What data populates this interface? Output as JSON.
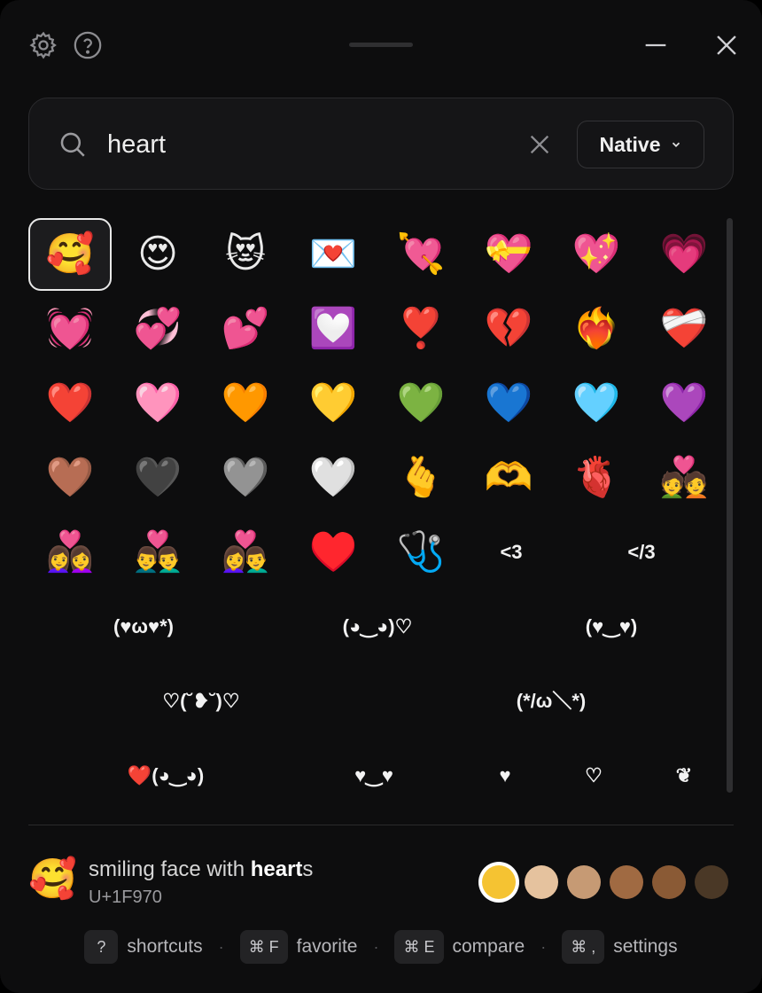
{
  "titlebar": {
    "icons": [
      "gear-icon",
      "help-icon",
      "minimize-icon",
      "close-icon"
    ]
  },
  "search": {
    "value": "heart",
    "mode_label": "Native"
  },
  "grid": {
    "emoji_rows": [
      [
        "🥰",
        "😍",
        "😻",
        "💌",
        "💘",
        "💝",
        "💖",
        "💗"
      ],
      [
        "💓",
        "💞",
        "💕",
        "💟",
        "❣️",
        "💔",
        "❤️‍🔥",
        "❤️‍🩹"
      ],
      [
        "❤️",
        "🩷",
        "🧡",
        "💛",
        "💚",
        "💙",
        "🩵",
        "💜"
      ],
      [
        "🤎",
        "🖤",
        "🩶",
        "🤍",
        "🫰",
        "🫶",
        "🫀",
        "💑"
      ],
      [
        "👩‍❤️‍👩",
        "👨‍❤️‍👨",
        "👩‍❤️‍👨",
        "♥️",
        "🩺"
      ]
    ],
    "row5_text": [
      "<3",
      "</3"
    ],
    "row6": [
      "(♥ω♥*)",
      "(◕‿◕)♡",
      "(♥‿♥)"
    ],
    "row7": [
      "♡(˘❥˘)♡",
      "(*/ω＼*)"
    ],
    "row8": [
      "❤️(◕‿◕)",
      "♥‿♥",
      "♥",
      "♡",
      "❦"
    ]
  },
  "preview": {
    "emoji": "🥰",
    "name_prefix": "smiling face with ",
    "name_match": "heart",
    "name_suffix": "s",
    "code": "U+1F970"
  },
  "skin_tones": [
    "#f5c332",
    "#e5c29e",
    "#c69a74",
    "#a06a42",
    "#8a5a35",
    "#4a3826"
  ],
  "shortcuts": [
    {
      "key": "?",
      "label": "shortcuts"
    },
    {
      "key": "⌘ F",
      "label": "favorite"
    },
    {
      "key": "⌘ E",
      "label": "compare"
    },
    {
      "key": "⌘ ,",
      "label": "settings"
    }
  ],
  "separator": "·"
}
